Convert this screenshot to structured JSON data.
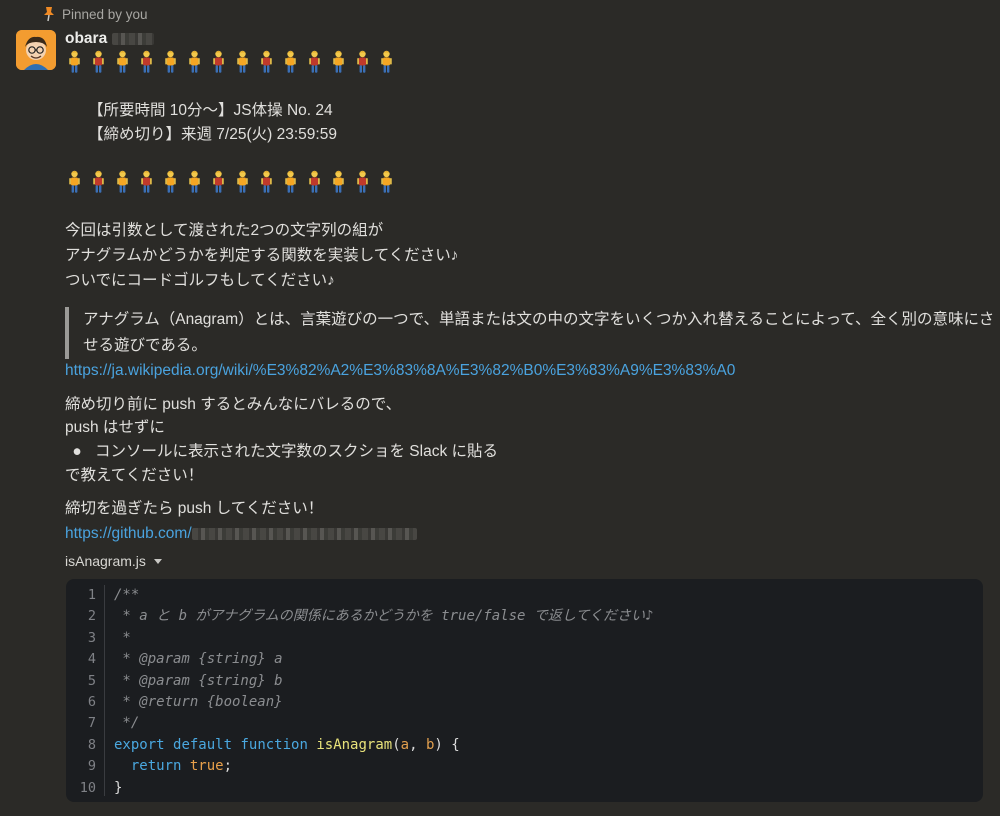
{
  "pinned": {
    "text": "Pinned by you"
  },
  "user": {
    "name": "obara"
  },
  "lines": {
    "time": "【所要時間 10分〜】JS体操 No. 24",
    "deadline": "【締め切り】来週 7/25(火) 23:59:59",
    "p1": "今回は引数として渡された2つの文字列の組が",
    "p2": "アナグラムかどうかを判定する関数を実装してください♪",
    "p3": "ついでにコードゴルフもしてください♪",
    "quote": "アナグラム（Anagram）とは、言葉遊びの一つで、単語または文の中の文字をいくつか入れ替えることによって、全く別の意味にさせる遊びである。",
    "wiki_link": "https://ja.wikipedia.org/wiki/%E3%82%A2%E3%83%8A%E3%82%B0%E3%83%A9%E3%83%A0",
    "p4": "締め切り前に push するとみんなにバレるので、",
    "p5": "push はせずに",
    "bullet_mark": "●",
    "bullet": "コンソールに表示された文字数のスクショを Slack に貼る",
    "p6": "で教えてください！",
    "p7": "締切を過ぎたら push してください！",
    "gh_link": "https://github.com/"
  },
  "file": {
    "name": "isAnagram.js"
  },
  "code": {
    "line_numbers": [
      "1",
      "2",
      "3",
      "4",
      "5",
      "6",
      "7",
      "8",
      "9",
      "10"
    ],
    "l1": "/**",
    "l2": " * a と b がアナグラムの関係にあるかどうかを true/false で返してください♪",
    "l3": " *",
    "l4": " * @param {string} a",
    "l5": " * @param {string} b",
    "l6": " * @return {boolean}",
    "l7": " */",
    "l8_kw1": "export",
    "l8_kw2": "default",
    "l8_kw3": "function",
    "l8_fn": "isAnagram",
    "l8_open": "(",
    "l8_a": "a",
    "l8_comma": ", ",
    "l8_b": "b",
    "l8_close": ") {",
    "l9_kw": "return",
    "l9_val": "true",
    "l9_semi": ";",
    "l10": "}"
  },
  "emoji": {
    "row_colors": [
      "#f5a623",
      "#c0392b",
      "#f5a623",
      "#c0392b",
      "#f5a623",
      "#f5a623",
      "#c0392b",
      "#f5a623",
      "#c0392b",
      "#f5a623",
      "#c0392b",
      "#f5a623",
      "#c0392b",
      "#f5a623"
    ],
    "icon": "person-standing-icon"
  },
  "colors": {
    "link": "#4aa3df",
    "background": "#2b2a27",
    "code_bg": "#1b1d20"
  }
}
